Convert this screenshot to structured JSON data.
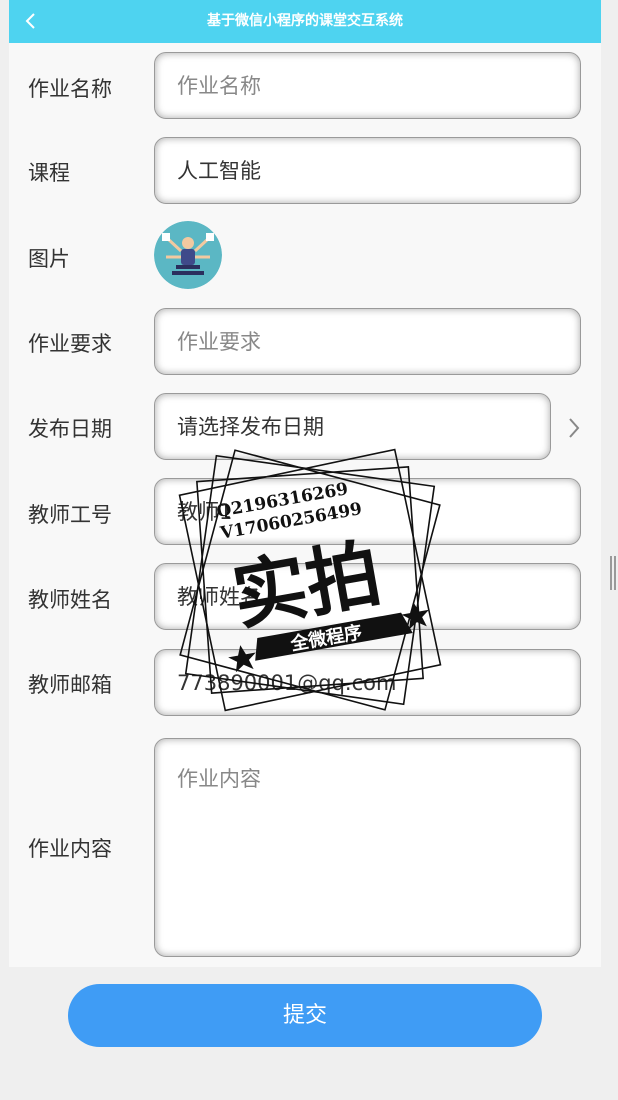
{
  "navbar": {
    "title": "基于微信小程序的课堂交互系统",
    "back_icon": "chevron-left-icon"
  },
  "form": {
    "assignment_name": {
      "label": "作业名称",
      "placeholder": "作业名称",
      "value": ""
    },
    "course": {
      "label": "课程",
      "value": "人工智能"
    },
    "image": {
      "label": "图片",
      "icon": "avatar-image"
    },
    "requirement": {
      "label": "作业要求",
      "placeholder": "作业要求",
      "value": ""
    },
    "publish_date": {
      "label": "发布日期",
      "value": "请选择发布日期",
      "chevron": "chevron-right-icon"
    },
    "teacher_id": {
      "label": "教师工号",
      "value": "教师1"
    },
    "teacher_name": {
      "label": "教师姓名",
      "value": "教师姓名"
    },
    "teacher_email": {
      "label": "教师邮箱",
      "value": "773890001@qq.com"
    },
    "content": {
      "label": "作业内容",
      "placeholder": "作业内容",
      "value": ""
    }
  },
  "submit": {
    "label": "提交"
  },
  "watermark": {
    "line1": "Q2196316269",
    "line2": "V17060256499",
    "big": "实拍",
    "banner": "全微程序"
  },
  "colors": {
    "navbar": "#4ed3f0",
    "submit": "#3f9cf5"
  }
}
